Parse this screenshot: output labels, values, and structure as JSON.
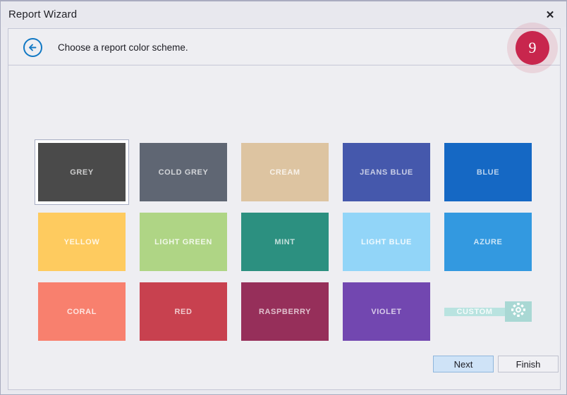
{
  "window": {
    "title": "Report Wizard",
    "close_label": "✕"
  },
  "header": {
    "back_icon": "back-arrow-circle-icon",
    "caption": "Choose a report color scheme."
  },
  "badge": {
    "step": "9"
  },
  "schemes": [
    {
      "label": "GREY",
      "color": "#4a4a4a",
      "selected": true,
      "text_color": "rgba(255,255,255,0.72)"
    },
    {
      "label": "COLD GREY",
      "color": "#5f6673",
      "selected": false,
      "text_color": "rgba(255,255,255,0.72)"
    },
    {
      "label": "CREAM",
      "color": "#ddc4a1",
      "selected": false,
      "text_color": "rgba(255,255,255,0.78)"
    },
    {
      "label": "JEANS BLUE",
      "color": "#4558ac",
      "selected": false,
      "text_color": "rgba(255,255,255,0.70)"
    },
    {
      "label": "BLUE",
      "color": "#1568c4",
      "selected": false,
      "text_color": "rgba(255,255,255,0.70)"
    },
    {
      "label": "YELLOW",
      "color": "#fecb5f",
      "selected": false,
      "text_color": "rgba(255,255,255,0.82)"
    },
    {
      "label": "LIGHT GREEN",
      "color": "#afd585",
      "selected": false,
      "text_color": "rgba(255,255,255,0.82)"
    },
    {
      "label": "MINT",
      "color": "#2c9080",
      "selected": false,
      "text_color": "rgba(255,255,255,0.72)"
    },
    {
      "label": "LIGHT BLUE",
      "color": "#92d5f8",
      "selected": false,
      "text_color": "rgba(255,255,255,0.85)"
    },
    {
      "label": "AZURE",
      "color": "#3399e0",
      "selected": false,
      "text_color": "rgba(255,255,255,0.75)"
    },
    {
      "label": "CORAL",
      "color": "#f8806e",
      "selected": false,
      "text_color": "rgba(255,255,255,0.80)"
    },
    {
      "label": "RED",
      "color": "#c8414f",
      "selected": false,
      "text_color": "rgba(255,255,255,0.72)"
    },
    {
      "label": "RASPBERRY",
      "color": "#962f5a",
      "selected": false,
      "text_color": "rgba(255,255,255,0.70)"
    },
    {
      "label": "VIOLET",
      "color": "#7247b0",
      "selected": false,
      "text_color": "rgba(255,255,255,0.72)"
    },
    {
      "label": "CUSTOM",
      "color": "#b9e3e0",
      "color_alt": "#a9d8d4",
      "selected": false,
      "custom": true,
      "icon": "gear-icon",
      "text_color": "rgba(255,255,255,0.85)"
    }
  ],
  "footer": {
    "next_label": "Next",
    "finish_label": "Finish"
  }
}
